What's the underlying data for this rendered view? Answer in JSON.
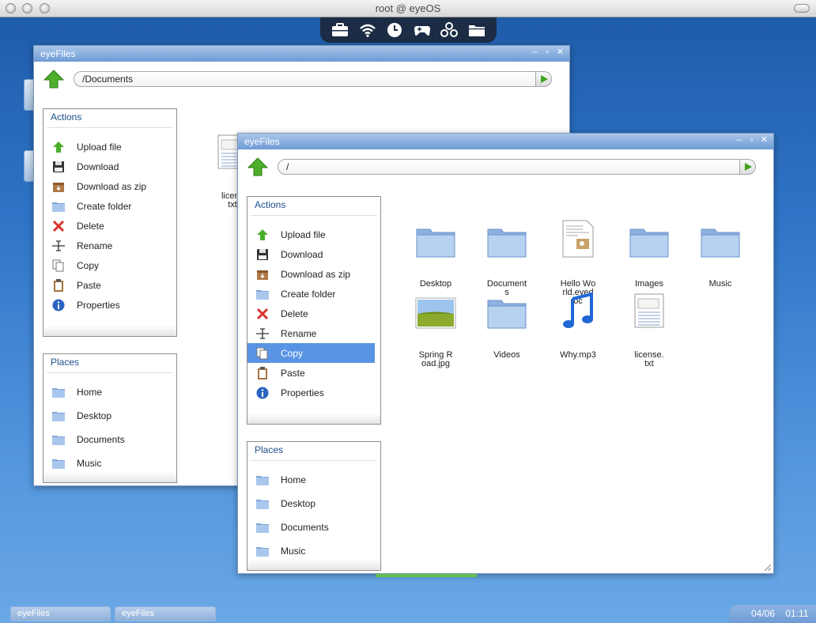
{
  "mac": {
    "title": "root @ eyeOS"
  },
  "dock": {
    "icons": [
      "briefcase-icon",
      "wifi-icon",
      "clock-icon",
      "gamepad-icon",
      "apps-icon",
      "folder-icon"
    ]
  },
  "back_window": {
    "title": "eyeFiles",
    "path": "/Documents",
    "actions_title": "Actions",
    "actions": [
      "Upload file",
      "Download",
      "Download as zip",
      "Create folder",
      "Delete",
      "Rename",
      "Copy",
      "Paste",
      "Properties"
    ],
    "places_title": "Places",
    "places": [
      "Home",
      "Desktop",
      "Documents",
      "Music"
    ],
    "files": [
      {
        "name": "licens\ntxt"
      }
    ]
  },
  "front_window": {
    "title": "eyeFiles",
    "path": "/",
    "actions_title": "Actions",
    "actions": [
      "Upload file",
      "Download",
      "Download as zip",
      "Create folder",
      "Delete",
      "Rename",
      "Copy",
      "Paste",
      "Properties"
    ],
    "selected_action": "Copy",
    "places_title": "Places",
    "places": [
      "Home",
      "Desktop",
      "Documents",
      "Music"
    ],
    "files": [
      {
        "name": "Desktop",
        "type": "folder"
      },
      {
        "name": "Document\ns",
        "type": "folder"
      },
      {
        "name": "Hello Wo\nrld.eyed\noc",
        "type": "doc"
      },
      {
        "name": "Images",
        "type": "folder"
      },
      {
        "name": "Music",
        "type": "folder"
      },
      {
        "name": "Spring R\noad.jpg",
        "type": "image"
      },
      {
        "name": "Videos",
        "type": "folder"
      },
      {
        "name": "Why.mp3",
        "type": "music"
      },
      {
        "name": "license.\ntxt",
        "type": "text"
      }
    ]
  },
  "taskbar": {
    "items": [
      "eyeFiles",
      "eyeFiles"
    ],
    "date": "04/06",
    "time": "01:11"
  },
  "colors": {
    "accent": "#5994e4",
    "desktop": "#2f74c6",
    "panel_title": "#1d4f8c"
  }
}
